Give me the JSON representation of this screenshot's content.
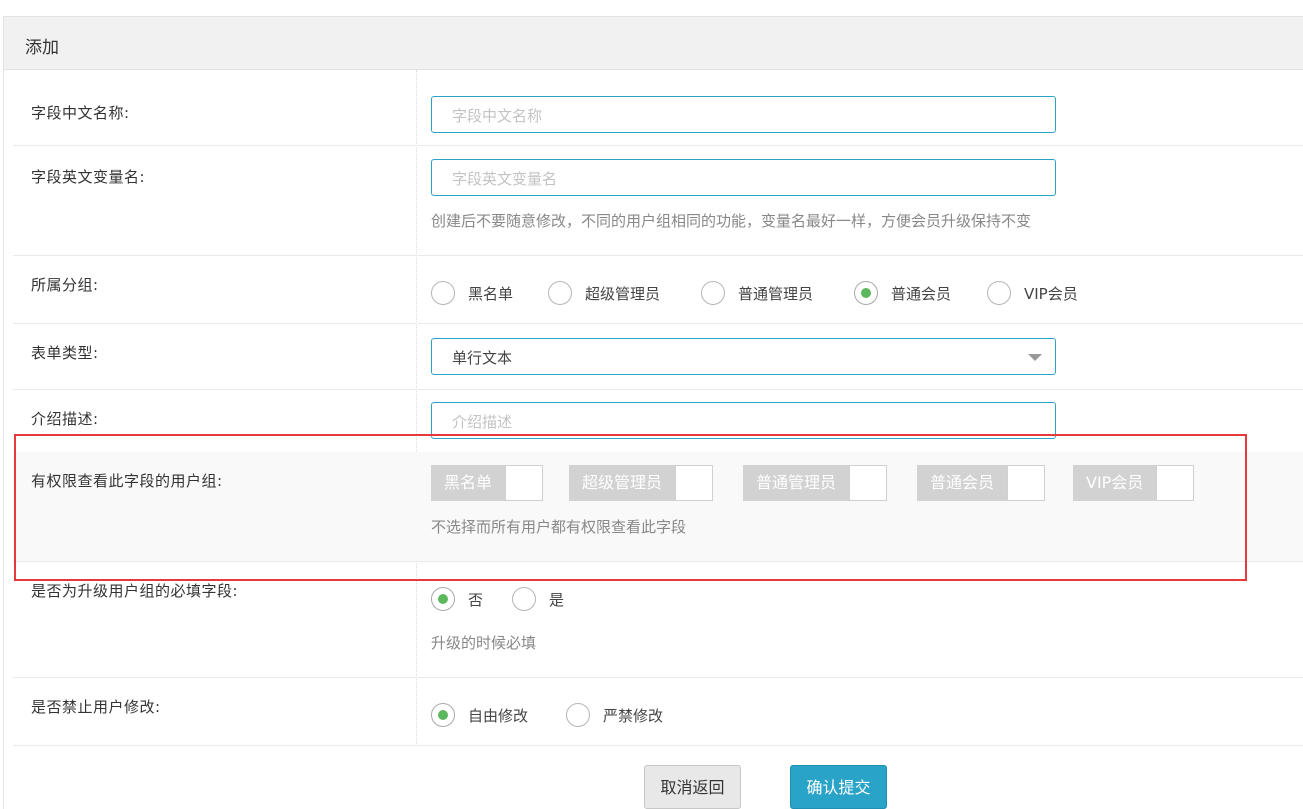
{
  "panel": {
    "title": "添加"
  },
  "fields": {
    "cn_name": {
      "label": "字段中文名称:",
      "placeholder": "字段中文名称",
      "value": ""
    },
    "en_name": {
      "label": "字段英文变量名:",
      "placeholder": "字段英文变量名",
      "value": "",
      "help": "创建后不要随意修改，不同的用户组相同的功能，变量名最好一样，方便会员升级保持不变"
    },
    "group": {
      "label": "所属分组:",
      "options": [
        "黑名单",
        "超级管理员",
        "普通管理员",
        "普通会员",
        "VIP会员"
      ],
      "selected": "普通会员"
    },
    "form_type": {
      "label": "表单类型:",
      "value": "单行文本"
    },
    "description": {
      "label": "介绍描述:",
      "placeholder": "介绍描述",
      "value": ""
    },
    "view_groups": {
      "label": "有权限查看此字段的用户组:",
      "toggles": [
        "黑名单",
        "超级管理员",
        "普通管理员",
        "普通会员",
        "VIP会员"
      ],
      "help": "不选择而所有用户都有权限查看此字段"
    },
    "required_upgrade": {
      "label": "是否为升级用户组的必填字段:",
      "options": [
        "否",
        "是"
      ],
      "selected": "否",
      "help": "升级的时候必填"
    },
    "forbid_edit": {
      "label": "是否禁止用户修改:",
      "options": [
        "自由修改",
        "严禁修改"
      ],
      "selected": "自由修改"
    }
  },
  "actions": {
    "cancel_label": "取消返回",
    "submit_label": "确认提交"
  },
  "colors": {
    "accent": "#2aa3c9",
    "radio_checked": "#5cb85c",
    "highlight_border": "#e5393b",
    "toggle_bg": "#d2d2d2"
  }
}
